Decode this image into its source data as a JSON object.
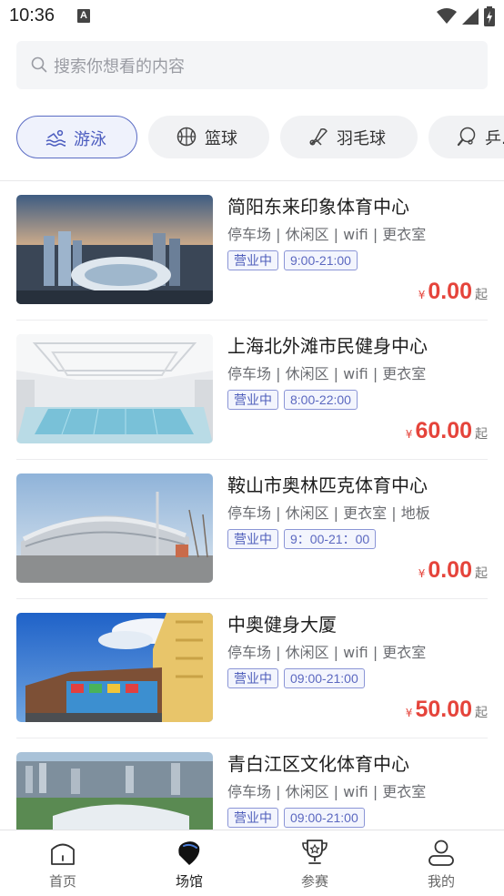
{
  "status_bar": {
    "time": "10:36",
    "notification_glyph": "A"
  },
  "search": {
    "placeholder": "搜索你想看的内容"
  },
  "categories": [
    {
      "label": "游泳",
      "icon": "swim-icon",
      "active": true
    },
    {
      "label": "篮球",
      "icon": "basketball-icon",
      "active": false
    },
    {
      "label": "羽毛球",
      "icon": "badminton-icon",
      "active": false
    },
    {
      "label": "乒...",
      "icon": "pingpong-icon",
      "active": false
    }
  ],
  "venues": [
    {
      "name": "简阳东来印象体育中心",
      "facilities": "停车场 | 休闲区 | wifi | 更衣室",
      "status": "营业中",
      "hours": "9:00-21:00",
      "currency": "¥",
      "price": "0.00",
      "price_suffix": "起"
    },
    {
      "name": "上海北外滩市民健身中心",
      "facilities": "停车场 | 休闲区 | wifi | 更衣室",
      "status": "营业中",
      "hours": "8:00-22:00",
      "currency": "¥",
      "price": "60.00",
      "price_suffix": "起"
    },
    {
      "name": "鞍山市奥林匹克体育中心",
      "facilities": "停车场 | 休闲区 | 更衣室 | 地板",
      "status": "营业中",
      "hours": "9：00-21：00",
      "currency": "¥",
      "price": "0.00",
      "price_suffix": "起"
    },
    {
      "name": "中奥健身大厦",
      "facilities": "停车场 | 休闲区 | wifi | 更衣室",
      "status": "营业中",
      "hours": "09:00-21:00",
      "currency": "¥",
      "price": "50.00",
      "price_suffix": "起"
    },
    {
      "name": "青白江区文化体育中心",
      "facilities": "停车场 | 休闲区 | wifi | 更衣室",
      "status": "营业中",
      "hours": "09:00-21:00",
      "currency": "¥",
      "price": "",
      "price_suffix": ""
    }
  ],
  "bottom_nav": [
    {
      "label": "首页",
      "icon": "home-icon",
      "active": false
    },
    {
      "label": "场馆",
      "icon": "venue-icon",
      "active": true
    },
    {
      "label": "参赛",
      "icon": "trophy-icon",
      "active": false
    },
    {
      "label": "我的",
      "icon": "profile-icon",
      "active": false
    }
  ],
  "colors": {
    "accent": "#5b6cc4",
    "price": "#e5443b",
    "tag_border": "#8b95d6"
  }
}
